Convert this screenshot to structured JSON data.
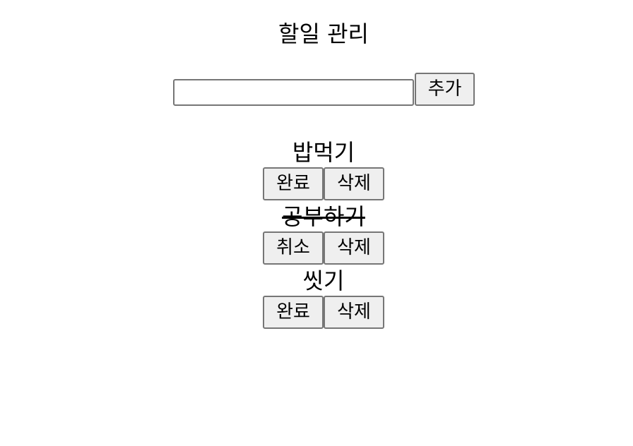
{
  "header": {
    "title": "할일 관리"
  },
  "add_form": {
    "input_value": "",
    "input_placeholder": "",
    "add_label": "추가"
  },
  "todos": [
    {
      "text": "밥먹기",
      "done": false,
      "toggle_label": "완료",
      "delete_label": "삭제"
    },
    {
      "text": "공부하기",
      "done": true,
      "toggle_label": "취소",
      "delete_label": "삭제"
    },
    {
      "text": "씻기",
      "done": false,
      "toggle_label": "완료",
      "delete_label": "삭제"
    }
  ]
}
